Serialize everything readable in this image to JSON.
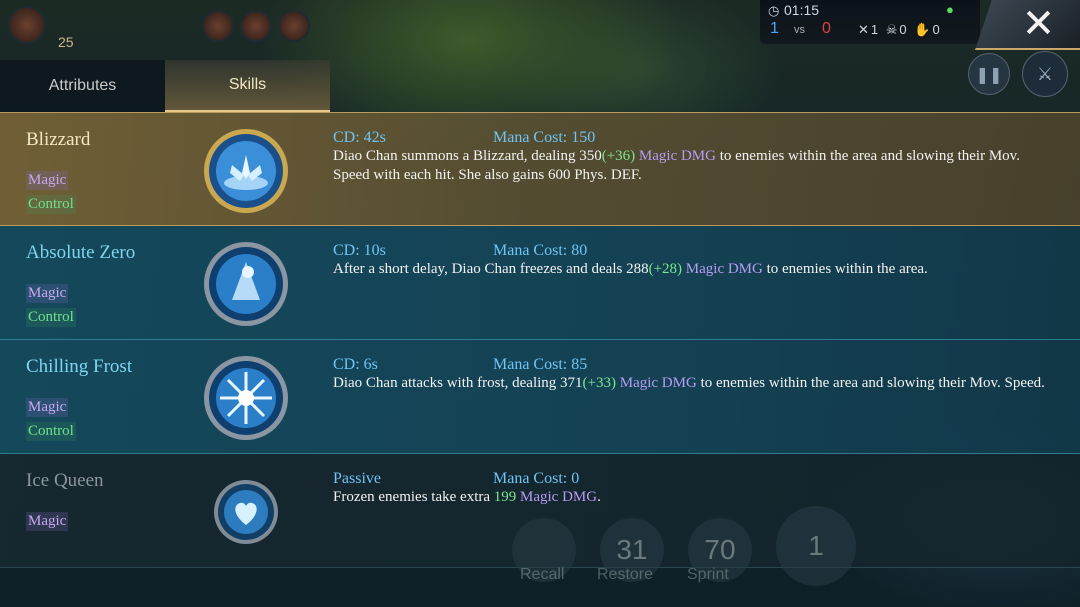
{
  "hud": {
    "level": "25",
    "timer": "01:15",
    "score_blue": "1",
    "vs": "vs",
    "score_red": "0",
    "kills": "1",
    "deaths": "0",
    "assists": "0",
    "close_icon": "close-icon",
    "pause_icon": "pause-icon",
    "sword_icon": "sword-icon"
  },
  "tabs": [
    {
      "label": "Attributes",
      "active": false
    },
    {
      "label": "Skills",
      "active": true
    }
  ],
  "skills": [
    {
      "name": "Blizzard",
      "tags": [
        "Magic",
        "Control"
      ],
      "cd": "CD: 42s",
      "mana": "Mana Cost: 150",
      "desc_a": "Diao Chan summons a Blizzard, dealing 350",
      "desc_bonus": "(+36)",
      "desc_dmg": "Magic DMG",
      "desc_b": "to enemies within the area and slowing their Mov. Speed with each hit. She also gains 600 Phys. DEF.",
      "icon": "blizzard-icon"
    },
    {
      "name": "Absolute Zero",
      "tags": [
        "Magic",
        "Control"
      ],
      "cd": "CD: 10s",
      "mana": "Mana Cost: 80",
      "desc_a": "After a short delay, Diao Chan freezes and deals 288",
      "desc_bonus": "(+28)",
      "desc_dmg": "Magic DMG",
      "desc_b": "to enemies within the area.",
      "icon": "absolute-zero-icon"
    },
    {
      "name": "Chilling Frost",
      "tags": [
        "Magic",
        "Control"
      ],
      "cd": "CD: 6s",
      "mana": "Mana Cost: 85",
      "desc_a": "Diao Chan attacks with frost, dealing 371",
      "desc_bonus": "(+33)",
      "desc_dmg": "Magic DMG",
      "desc_b": "to enemies within the area and slowing their Mov. Speed.",
      "icon": "chilling-frost-icon"
    },
    {
      "name": "Ice Queen",
      "tags": [
        "Magic"
      ],
      "cd": "Passive",
      "mana": "Mana Cost: 0",
      "desc_a": "Frozen enemies take extra",
      "desc_bonus": "199",
      "desc_dmg": "Magic DMG",
      "desc_b": ".",
      "icon": "ice-queen-heart-icon"
    }
  ],
  "bottom_buttons": [
    {
      "label": "Recall",
      "value": ""
    },
    {
      "label": "Restore",
      "value": "31"
    },
    {
      "label": "Sprint",
      "value": "70"
    },
    {
      "label": "",
      "value": "1"
    }
  ],
  "colors": {
    "selected_row": "#7a6437",
    "blue_row": "#145060",
    "magic_tag": "#c6a8f0",
    "control_tag": "#71e08e",
    "cd_text": "#6fc4f4",
    "bonus_text": "#7de58c",
    "magic_dmg_text": "#b69cf2"
  }
}
